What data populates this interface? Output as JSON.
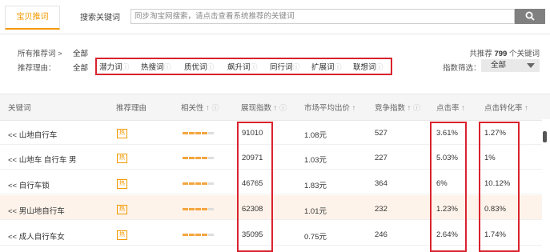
{
  "tabs": {
    "active": "宝贝推词",
    "second": "搜索关键词"
  },
  "search": {
    "placeholder": "同步淘宝网搜索，请点击查看系统推荐的关键词"
  },
  "filter": {
    "all_label": "所有推荐词 >",
    "all_value": "全部",
    "reason_label": "推荐理由：",
    "reason_all": "全部",
    "reasons": [
      "潜力词",
      "热搜词",
      "质优词",
      "飙升词",
      "同行词",
      "扩展词",
      "联想词"
    ],
    "count_prefix": "共推荐",
    "count_value": "799",
    "count_suffix": "个关键词",
    "screen_label": "指数筛选：",
    "screen_value": "全部"
  },
  "table": {
    "headers": [
      "关键词",
      "推荐理由",
      "相关性",
      "展现指数",
      "市场平均出价",
      "竞争指数",
      "点击率",
      "点击转化率"
    ],
    "rows": [
      {
        "keyword": "<< 山地自行车",
        "badge": "热",
        "relevance": 4,
        "impressions": "91010",
        "avg_bid": "1.08元",
        "competition": "527",
        "ctr": "3.61%",
        "cvr": "1.27%"
      },
      {
        "keyword": "<< 山地车 自行车 男",
        "badge": "热",
        "relevance": 4,
        "impressions": "20971",
        "avg_bid": "1.03元",
        "competition": "227",
        "ctr": "5.03%",
        "cvr": "1%"
      },
      {
        "keyword": "<< 自行车锁",
        "badge": "热",
        "relevance": 4,
        "impressions": "46765",
        "avg_bid": "1.83元",
        "competition": "364",
        "ctr": "6%",
        "cvr": "10.12%"
      },
      {
        "keyword": "<< 男山地自行车",
        "badge": "热",
        "relevance": 4,
        "impressions": "62308",
        "avg_bid": "1.01元",
        "competition": "232",
        "ctr": "1.23%",
        "cvr": "0.83%"
      },
      {
        "keyword": "<< 成人自行车女",
        "badge": "热",
        "relevance": 4,
        "impressions": "35095",
        "avg_bid": "0.75元",
        "competition": "246",
        "ctr": "2.64%",
        "cvr": "1.74%"
      }
    ]
  },
  "colors": {
    "accent": "#f39800",
    "highlight_box": "#d9232e",
    "relevance_on": "#f4a53f",
    "relevance_off": "#dddddd"
  }
}
